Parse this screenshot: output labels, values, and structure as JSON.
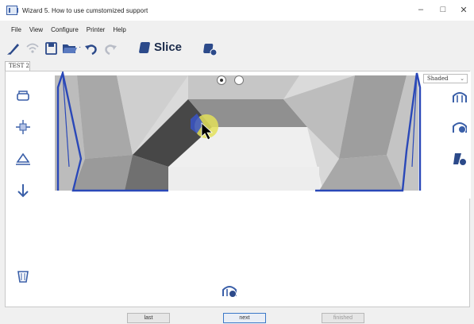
{
  "window": {
    "title": "Wizard   5. How to use cumstomized support",
    "controls": {
      "minimize": "–",
      "maximize": "□",
      "close": "✕"
    }
  },
  "menu": [
    "File",
    "View",
    "Configure",
    "Printer",
    "Help"
  ],
  "toolbar": {
    "slice_label": "Slice",
    "icons": [
      "brush-icon",
      "wifi-icon",
      "save-icon",
      "open-folder-icon",
      "undo-icon",
      "redo-icon",
      "slice-icon",
      "settings-icon"
    ]
  },
  "tab": {
    "label": "TEST 2"
  },
  "viewport": {
    "view_mode": "Shaded",
    "radio_selected": 0,
    "left_tools": [
      "move-icon",
      "align-center-icon",
      "lay-flat-icon",
      "drop-down-icon",
      "support-paint-icon"
    ],
    "right_tools": [
      "support-icon",
      "auto-support-icon",
      "custom-support-icon"
    ],
    "bottom_tool": "add-support-icon"
  },
  "colors": {
    "accent": "#2a48b8",
    "model_light": "#d2d2d2",
    "model_dark": "#4a4a4a",
    "highlight": "#e3e05a"
  },
  "footer": {
    "last_label": "last",
    "next_label": "next",
    "finished_label": "finished"
  }
}
